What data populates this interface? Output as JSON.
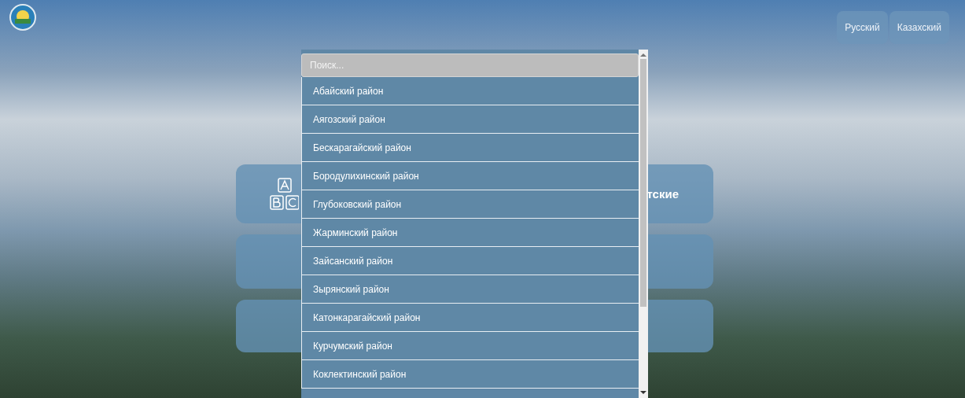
{
  "header": {
    "languages": [
      {
        "label": "Русский"
      },
      {
        "label": "Казахский"
      }
    ]
  },
  "cards": [
    {
      "kind": "abc",
      "text": "тские"
    },
    {
      "kind": "plain"
    },
    {
      "kind": "plain"
    }
  ],
  "dropdown": {
    "search": {
      "placeholder": "Поиск..."
    },
    "options": [
      "Абайский район",
      "Аягозский район",
      "Бескарагайский район",
      "Бородулихинский район",
      "Глубоковский район",
      "Жарминский район",
      "Зайсанский район",
      "Зырянский район",
      "Катонкарагайский район",
      "Курчумский район",
      "Коклектинский район"
    ]
  }
}
